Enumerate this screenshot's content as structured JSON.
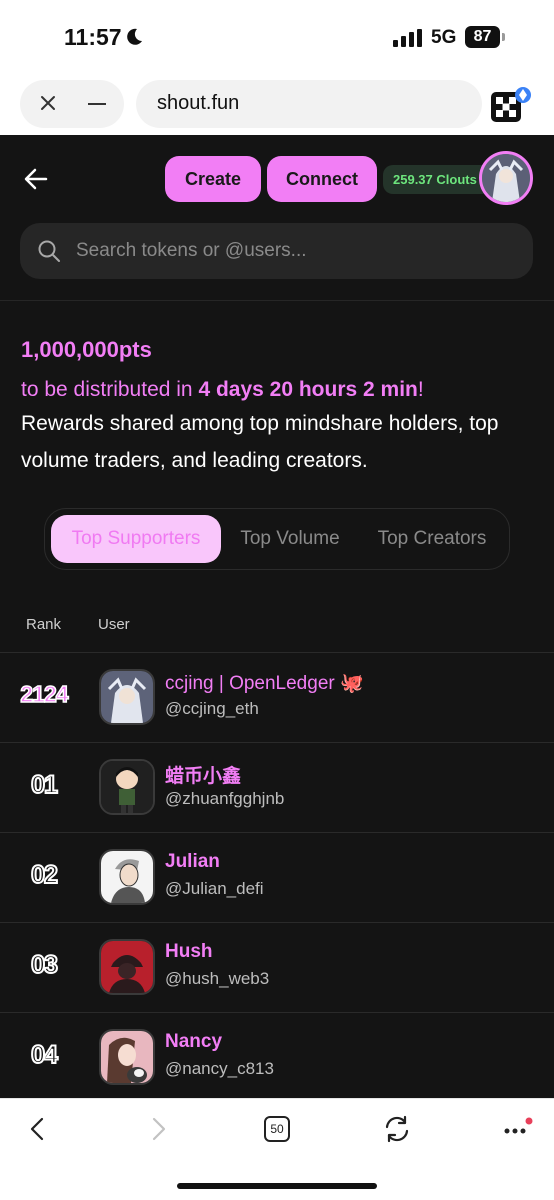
{
  "status_bar": {
    "time": "11:57",
    "network": "5G",
    "battery": "87"
  },
  "browser": {
    "url": "shout.fun"
  },
  "header": {
    "create_label": "Create",
    "connect_label": "Connect",
    "clouts": "259.37 Clouts"
  },
  "search": {
    "placeholder": "Search tokens or @users..."
  },
  "promo": {
    "points": "1,000,000pts",
    "distribute_prefix": "to be distributed in ",
    "distribute_time": "4 days 20 hours 2 min",
    "distribute_suffix": "!",
    "rewards_text": "Rewards shared among top mindshare holders, top volume traders, and leading creators."
  },
  "tabs": [
    {
      "label": "Top Supporters",
      "active": true
    },
    {
      "label": "Top Volume",
      "active": false
    },
    {
      "label": "Top Creators",
      "active": false
    }
  ],
  "table": {
    "headers": {
      "rank": "Rank",
      "user": "User"
    },
    "rows": [
      {
        "rank": "2124",
        "name": "ccjing | OpenLedger 🐙",
        "handle": "@ccjing_eth",
        "self": true
      },
      {
        "rank": "01",
        "name": "蜡币小鑫",
        "handle": "@zhuanfgghjnb"
      },
      {
        "rank": "02",
        "name": "Julian",
        "handle": "@Julian_defi"
      },
      {
        "rank": "03",
        "name": "Hush",
        "handle": "@hush_web3"
      },
      {
        "rank": "04",
        "name": "Nancy",
        "handle": "@nancy_c813"
      }
    ]
  },
  "toolbar": {
    "tab_count": "50"
  },
  "colors": {
    "accent": "#f27ef5",
    "background": "#141414",
    "clouts_text": "#6de57d"
  }
}
